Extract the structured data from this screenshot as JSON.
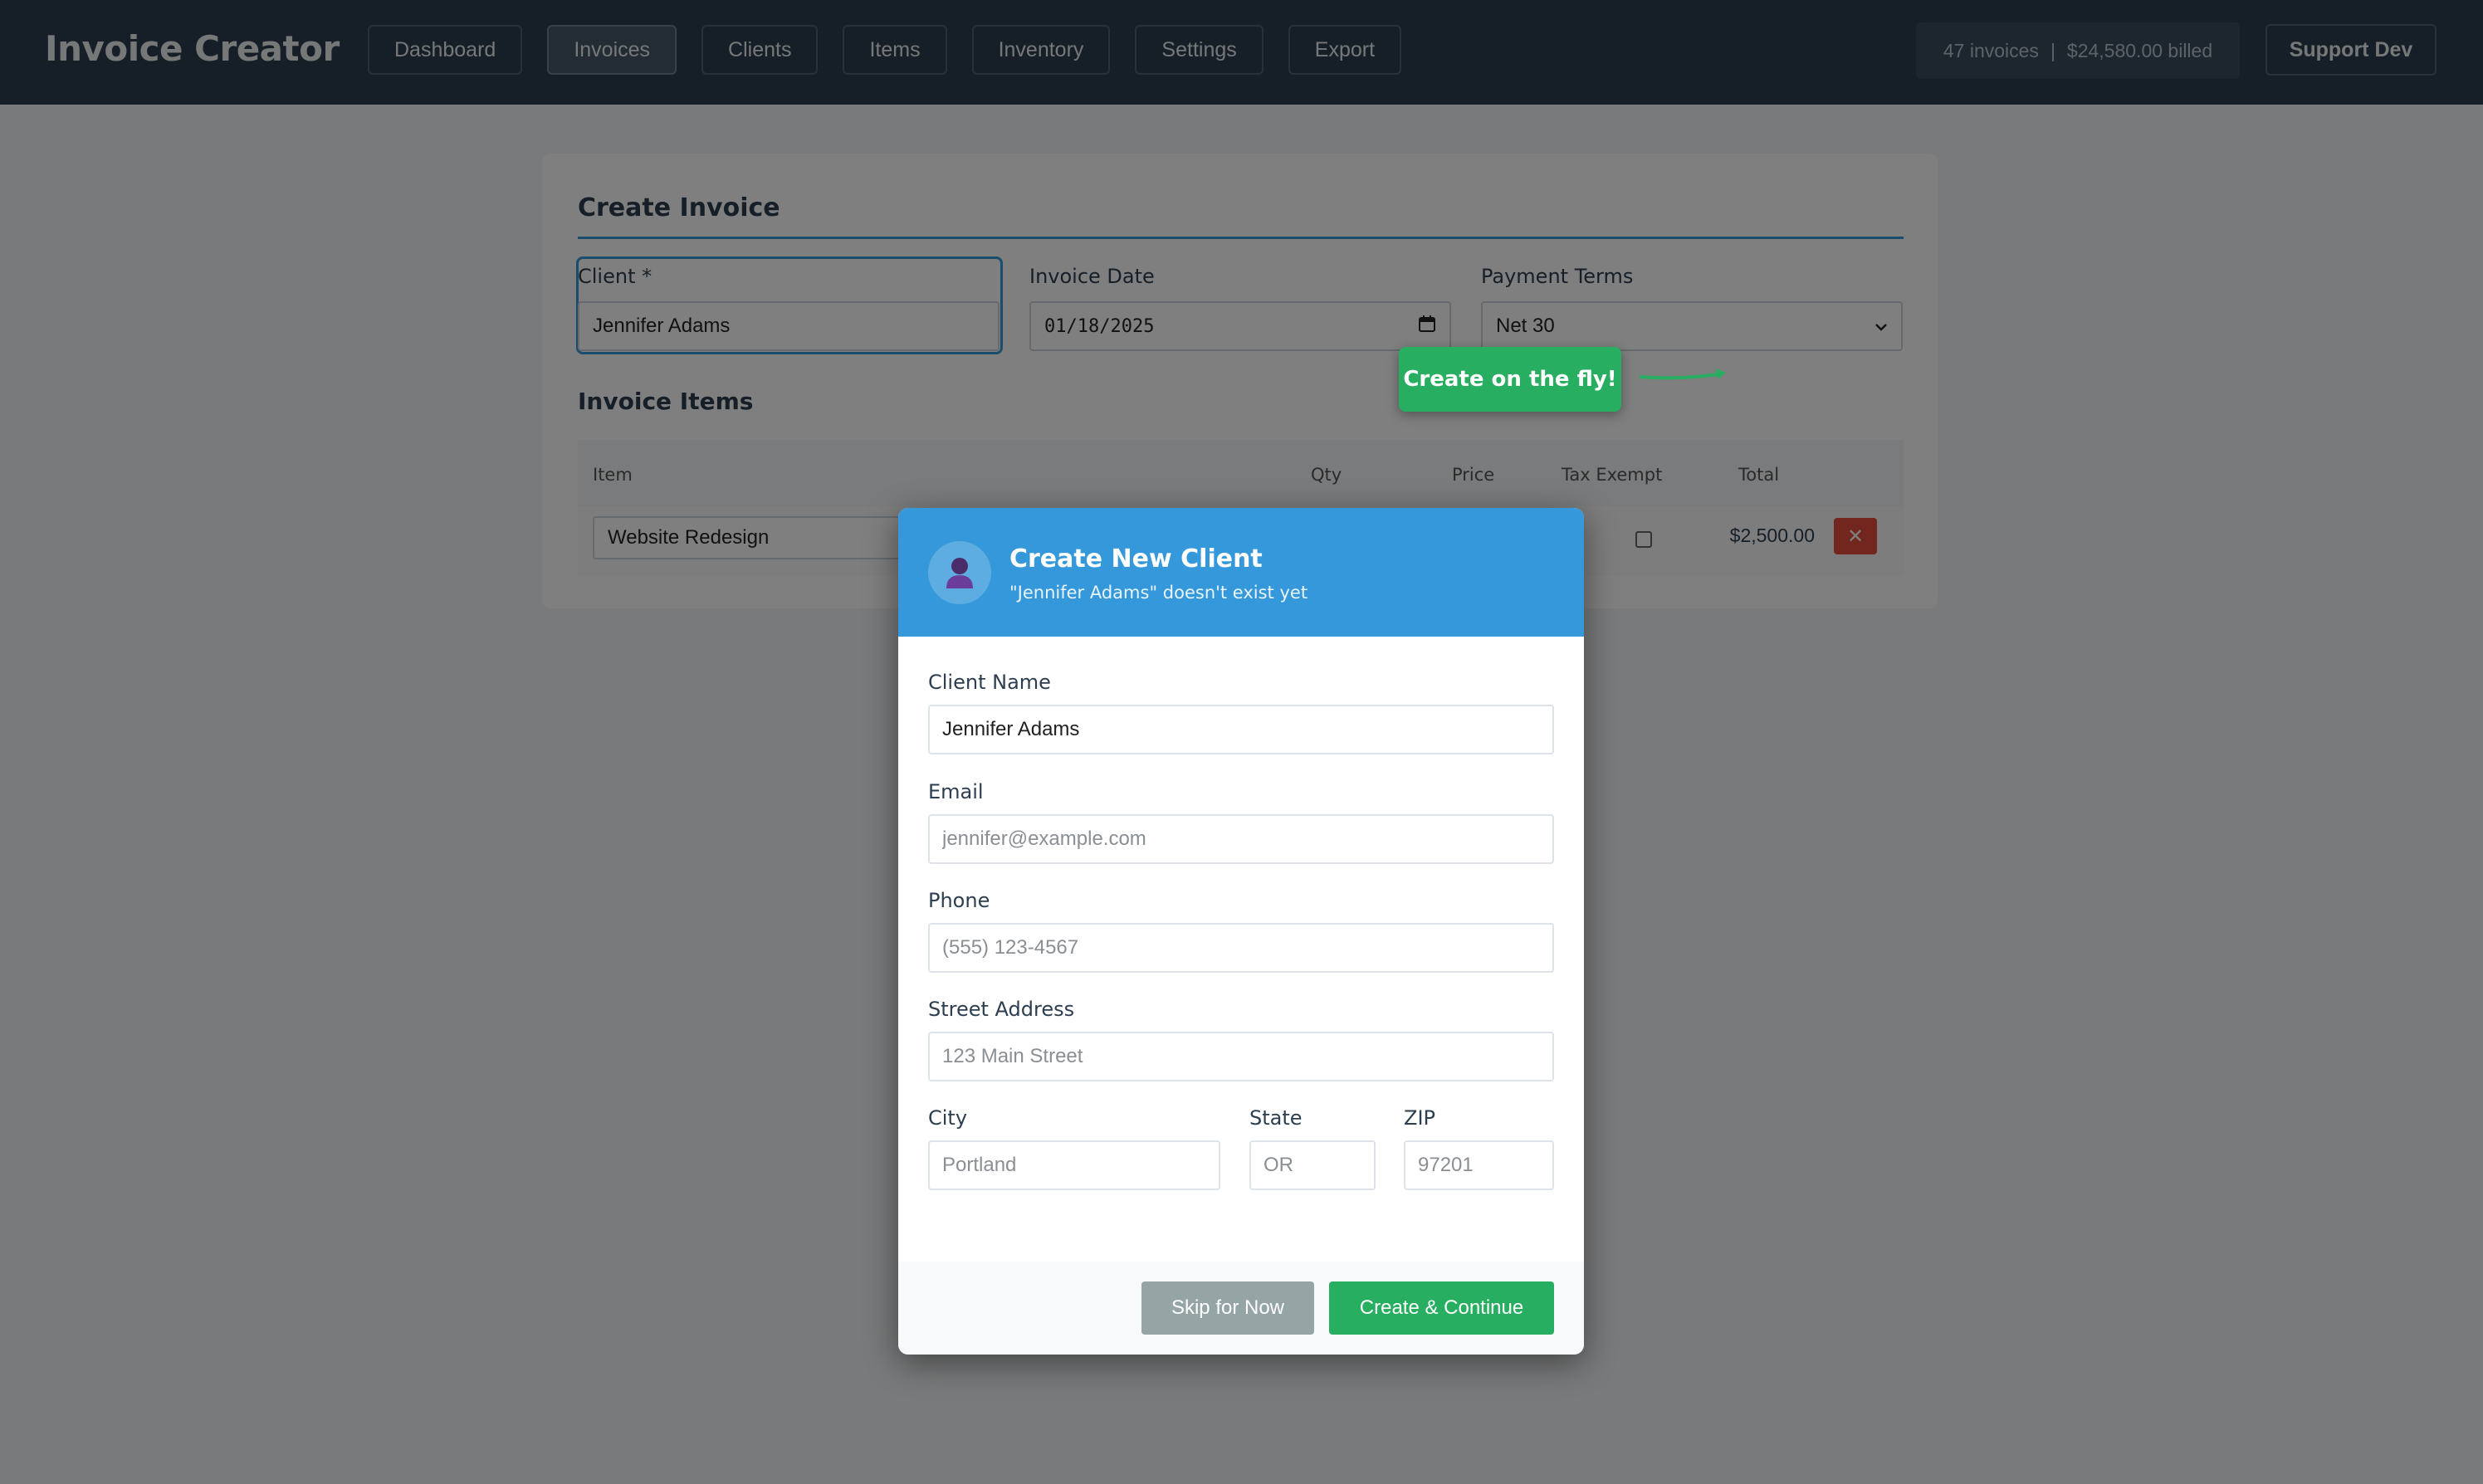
{
  "app": {
    "title": "Invoice Creator"
  },
  "nav": {
    "items": [
      {
        "label": "Dashboard",
        "active": false
      },
      {
        "label": "Invoices",
        "active": true
      },
      {
        "label": "Clients",
        "active": false
      },
      {
        "label": "Items",
        "active": false
      },
      {
        "label": "Inventory",
        "active": false
      },
      {
        "label": "Settings",
        "active": false
      },
      {
        "label": "Export",
        "active": false
      }
    ]
  },
  "stats": {
    "invoices": "47 invoices",
    "separator": "|",
    "billed": "$24,580.00 billed"
  },
  "support": {
    "label": "Support Dev"
  },
  "invoice": {
    "title": "Create Invoice",
    "client_label": "Client *",
    "client_value": "Jennifer Adams",
    "date_label": "Invoice Date",
    "date_value": "01/18/2025",
    "terms_label": "Payment Terms",
    "terms_value": "Net 30"
  },
  "items_section": {
    "title": "Invoice Items",
    "columns": {
      "item": "Item",
      "qty": "Qty",
      "price": "Price",
      "tax_exempt": "Tax Exempt",
      "total": "Total"
    },
    "rows": [
      {
        "item": "Website Redesign",
        "total": "$2,500.00",
        "tax_exempt": false
      }
    ]
  },
  "tooltip": {
    "text": "Create on the fly!"
  },
  "modal": {
    "title": "Create New Client",
    "subtitle": "\"Jennifer Adams\" doesn't exist yet",
    "name_label": "Client Name",
    "name_value": "Jennifer Adams",
    "email_label": "Email",
    "email_placeholder": "jennifer@example.com",
    "phone_label": "Phone",
    "phone_placeholder": "(555) 123-4567",
    "street_label": "Street Address",
    "street_placeholder": "123 Main Street",
    "city_label": "City",
    "city_placeholder": "Portland",
    "state_label": "State",
    "state_placeholder": "OR",
    "zip_label": "ZIP",
    "zip_placeholder": "97201",
    "skip_label": "Skip for Now",
    "create_label": "Create & Continue"
  },
  "colors": {
    "nav_bg": "#2c3e50",
    "accent": "#3498db",
    "success": "#27ae60",
    "danger": "#e74c3c"
  }
}
